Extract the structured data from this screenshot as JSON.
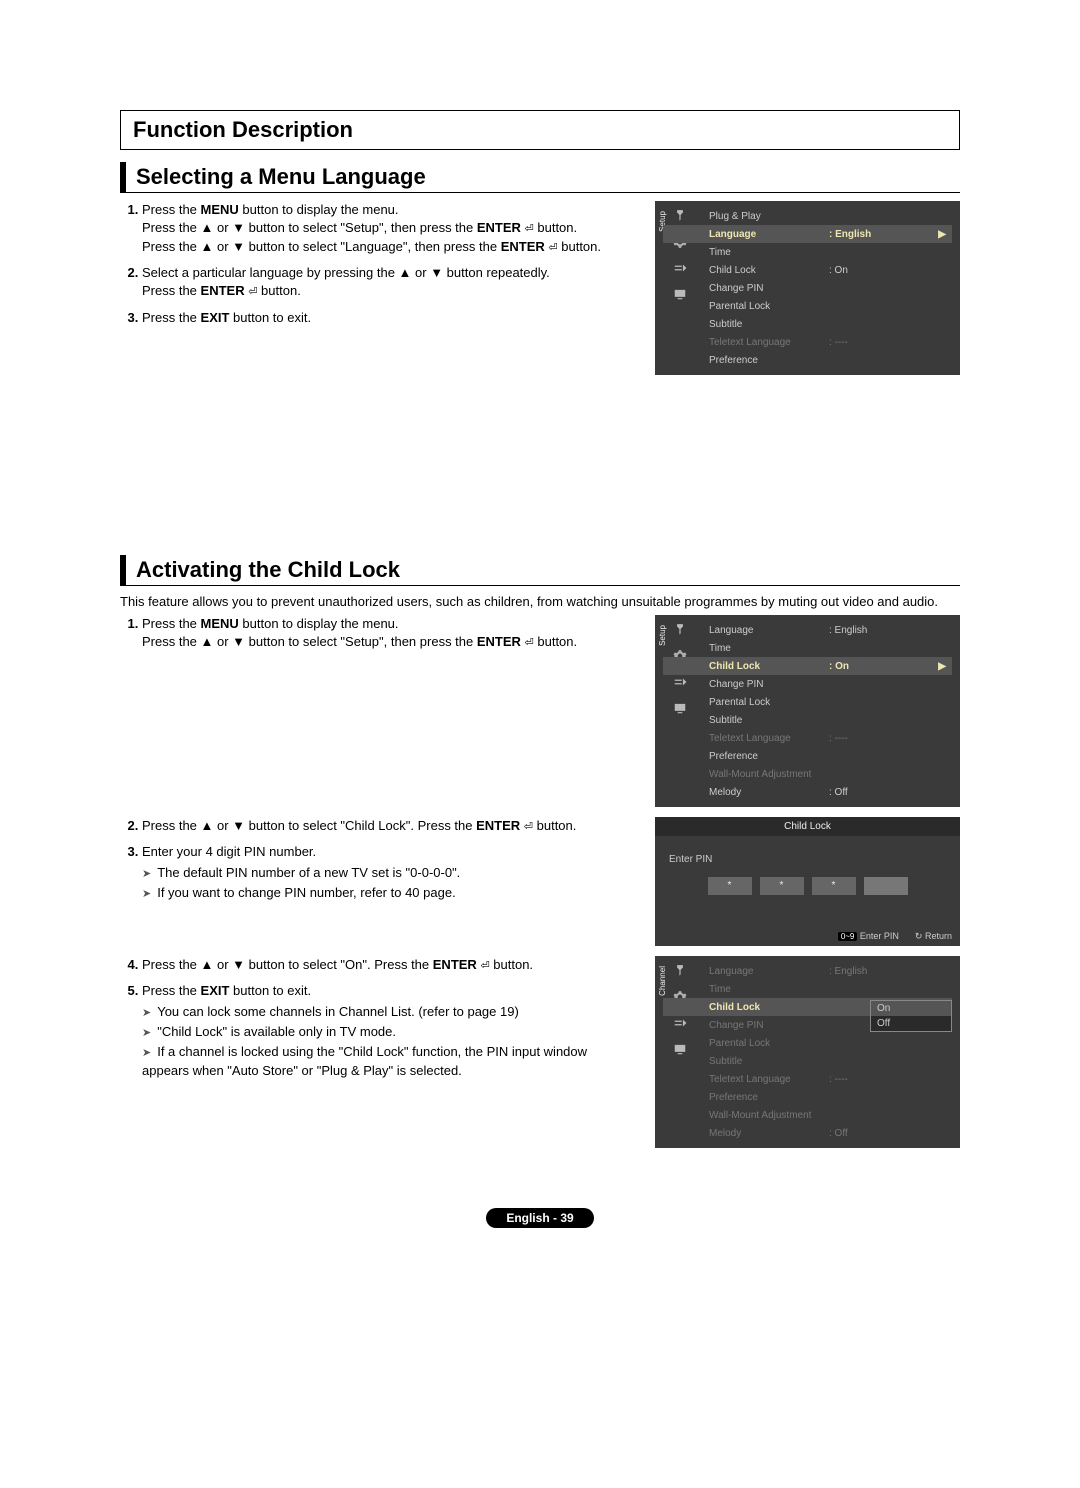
{
  "header": {
    "function_title": "Function Description"
  },
  "section1": {
    "title": "Selecting a Menu Language",
    "steps": {
      "s1a": "Press the ",
      "s1_menu": "MENU",
      "s1b": " button to display the menu.",
      "s1c": "Press the ▲ or ▼ button to select \"Setup\", then press the ",
      "s1_enter": "ENTER",
      "s1d": " button.",
      "s1e": "Press the ▲ or ▼ button to select \"Language\", then press the ",
      "s1f": " button.",
      "s2a": "Select a particular language by pressing the ▲ or ▼ button repeatedly.",
      "s2b": "Press the ",
      "s2c": " button.",
      "s3a": "Press the ",
      "s3_exit": "EXIT",
      "s3b": " button to exit."
    },
    "osd": {
      "sidebar": "Setup",
      "rows": [
        {
          "label": "Plug & Play",
          "value": ""
        },
        {
          "label": "Language",
          "value": ": English",
          "highlight": true
        },
        {
          "label": "Time",
          "value": ""
        },
        {
          "label": "Child Lock",
          "value": ": On"
        },
        {
          "label": "Change PIN",
          "value": ""
        },
        {
          "label": "Parental Lock",
          "value": ""
        },
        {
          "label": "Subtitle",
          "value": ""
        },
        {
          "label": "Teletext Language",
          "value": ": ----",
          "dim": true
        },
        {
          "label": "Preference",
          "value": ""
        }
      ]
    }
  },
  "section2": {
    "title": "Activating the Child Lock",
    "intro": "This feature allows you to prevent unauthorized users, such as children, from watching unsuitable programmes by muting out video and audio.",
    "steps": {
      "s1a": "Press the ",
      "s1_menu": "MENU",
      "s1b": " button to display the menu.",
      "s1c": "Press the ▲ or ▼ button to select \"Setup\", then press the ",
      "s1_enter": "ENTER",
      "s1d": " button.",
      "s2a": "Press the ▲ or ▼ button to select \"Child Lock\". Press the ",
      "s2b": " button.",
      "s3a": "Enter your 4 digit PIN number.",
      "s3_note1": "The default PIN number of a new TV set is \"0-0-0-0\".",
      "s3_note2": "If you want to change PIN number, refer to 40 page.",
      "s4a": "Press the ▲ or ▼ button to select \"On\". Press the ",
      "s4b": " button.",
      "s5a": "Press the ",
      "s5_exit": "EXIT",
      "s5b": " button to exit.",
      "s5_note1": "You can lock some channels in Channel List. (refer to page 19)",
      "s5_note2": "\"Child Lock\" is available only in TV mode.",
      "s5_note3": "If a channel is locked using the \"Child Lock\" function, the PIN input window appears when \"Auto Store\" or \"Plug & Play\" is selected."
    },
    "osd1": {
      "sidebar": "Setup",
      "rows": [
        {
          "label": "Language",
          "value": ": English"
        },
        {
          "label": "Time",
          "value": ""
        },
        {
          "label": "Child Lock",
          "value": ": On",
          "highlight": true
        },
        {
          "label": "Change PIN",
          "value": ""
        },
        {
          "label": "Parental Lock",
          "value": ""
        },
        {
          "label": "Subtitle",
          "value": ""
        },
        {
          "label": "Teletext Language",
          "value": ": ----",
          "dim": true
        },
        {
          "label": "Preference",
          "value": ""
        },
        {
          "label": "Wall-Mount Adjustment",
          "value": "",
          "dim": true
        },
        {
          "label": "Melody",
          "value": ": Off"
        }
      ]
    },
    "pin": {
      "title": "Child Lock",
      "enter_label": "Enter PIN",
      "digits": [
        "*",
        "*",
        "*",
        ""
      ],
      "footer_keys": "0~9",
      "footer_enter": "Enter PIN",
      "footer_return_icon": "↻",
      "footer_return": "Return"
    },
    "osd2": {
      "sidebar": "Channel",
      "rows": [
        {
          "label": "Language",
          "value": ": English",
          "dim": true
        },
        {
          "label": "Time",
          "value": "",
          "dim": true
        },
        {
          "label": "Child Lock",
          "value": "",
          "highlight": true
        },
        {
          "label": "Change PIN",
          "value": "",
          "dim": true
        },
        {
          "label": "Parental Lock",
          "value": "",
          "dim": true
        },
        {
          "label": "Subtitle",
          "value": "",
          "dim": true
        },
        {
          "label": "Teletext Language",
          "value": ": ----",
          "dim": true
        },
        {
          "label": "Preference",
          "value": "",
          "dim": true
        },
        {
          "label": "Wall-Mount Adjustment",
          "value": "",
          "dim": true
        },
        {
          "label": "Melody",
          "value": ": Off",
          "dim": true
        }
      ],
      "dropdown": {
        "options": [
          "On",
          "Off"
        ],
        "selected": 0
      }
    }
  },
  "footer": {
    "text": "English - 39"
  },
  "enter_glyph": "⏎"
}
